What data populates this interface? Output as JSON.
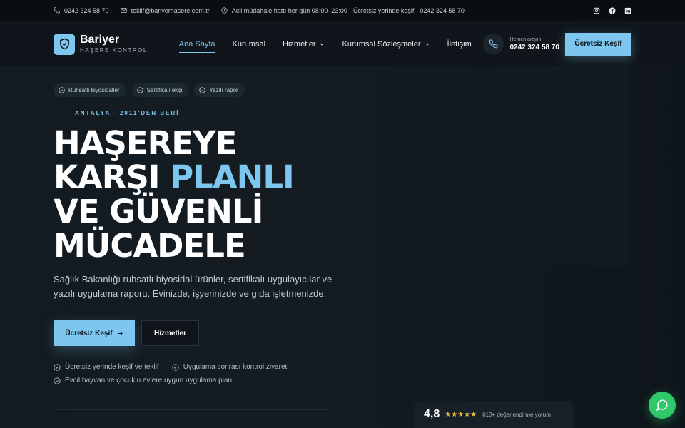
{
  "topbar": {
    "phone": "0242 324 58 70",
    "email": "teklif@bariyerhasere.com.tr",
    "hours": "Acil müdahale hattı her gün 08:00–23:00 · Ücretsiz yerinde keşif · 0242 324 58 70",
    "socials": [
      "instagram-icon",
      "facebook-icon",
      "linkedin-icon"
    ]
  },
  "brand": {
    "name": "Bariyer",
    "tagline": "HAŞERE KONTROL"
  },
  "nav": {
    "items": [
      {
        "label": "Ana Sayfa",
        "active": true
      },
      {
        "label": "Kurumsal"
      },
      {
        "label": "Hizmetler",
        "dropdown": true
      },
      {
        "label": "Kurumsal Sözleşmeler",
        "dropdown": true
      },
      {
        "label": "İletişim"
      }
    ],
    "call_small": "Hemen arayın",
    "call_number": "0242 324 58 70",
    "cta": "Ücretsiz Keşif"
  },
  "hero": {
    "chips": [
      "Ruhsatlı biyosidaller",
      "Sertifikalı ekip",
      "Yazılı rapor"
    ],
    "eyebrow": "ANTALYA · 2011'DEN BERİ",
    "headline_l1": "HAŞEREYE",
    "headline_l2a": "KARŞI",
    "headline_l2b": "PLANLI",
    "headline_l3": "VE GÜVENLİ",
    "headline_l4": "MÜCADELE",
    "lead": "Sağlık Bakanlığı ruhsatlı biyosidal ürünler, sertifikalı uygulayıcılar ve yazılı uygulama raporu. Evinizde, işyerinizde ve gıda işletmenizde.",
    "primary_btn": "Ücretsiz Keşif",
    "secondary_btn": "Hizmetler",
    "features": [
      "Ücretsiz yerinde keşif ve teklif",
      "Uygulama sonrası kontrol ziyareti",
      "Evcil hayvan ve çocuklu evlere uygun uygulama planı"
    ]
  },
  "rating": {
    "score": "4,8",
    "stars": "★★★★★",
    "reviews": "610+ değerlendirme yorum"
  },
  "colors": {
    "accent": "#7cc6ef",
    "background": "#0d1216",
    "star": "#f3c244",
    "chat": "#2ec86b"
  }
}
